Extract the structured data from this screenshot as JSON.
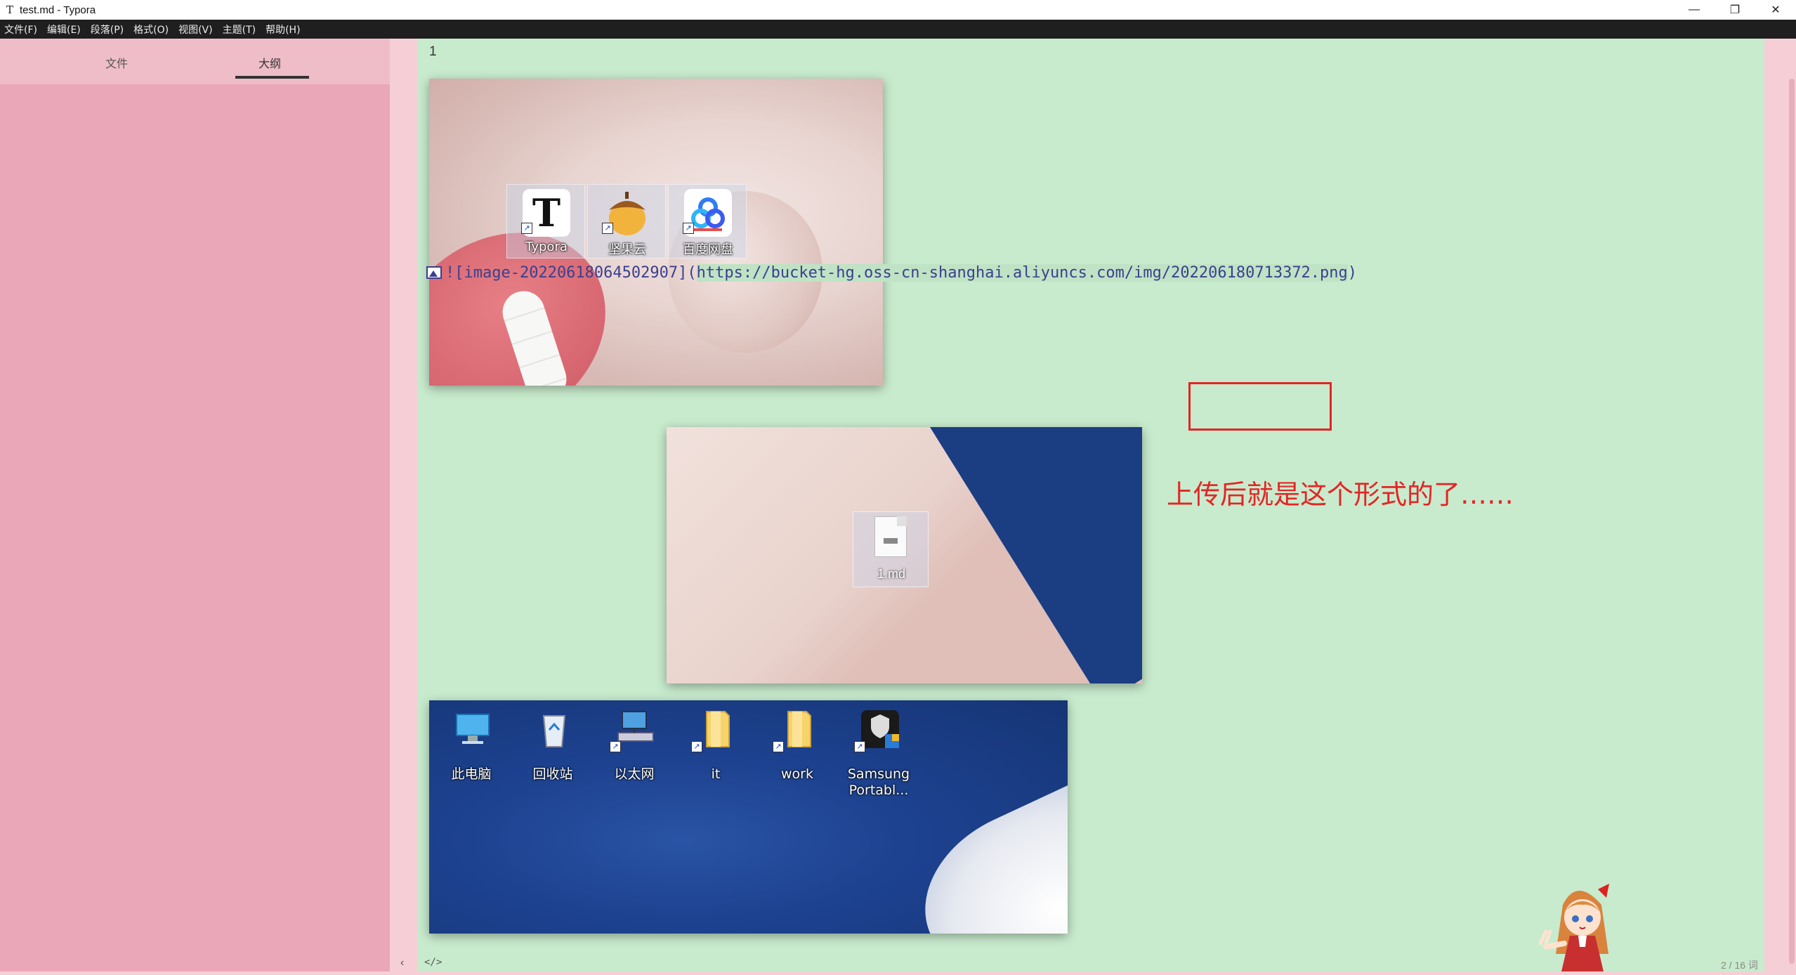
{
  "window": {
    "title": "test.md - Typora",
    "app_icon": "T",
    "controls": {
      "minimize": "—",
      "restore": "❐",
      "close": "✕"
    }
  },
  "menu": [
    "文件(F)",
    "编辑(E)",
    "段落(P)",
    "格式(O)",
    "视图(V)",
    "主题(T)",
    "帮助(H)"
  ],
  "sidebar": {
    "tabs": [
      {
        "label": "文件",
        "active": false
      },
      {
        "label": "大纲",
        "active": true
      }
    ]
  },
  "editor": {
    "line_number": "1",
    "image1_icons": [
      {
        "label": "Typora",
        "icon": "typora-icon"
      },
      {
        "label": "坚果云",
        "icon": "nutstore-icon"
      },
      {
        "label": "百度网盘",
        "icon": "baidu-netdisk-icon"
      }
    ],
    "markdown": {
      "prefix": "![image-20220618064502907](",
      "url": "https://bucket-hg.oss-cn-shanghai.aliyuncs.com/img/202206180713372.png",
      "suffix": ")"
    },
    "annotation": "上传后就是这个形式的了……",
    "image2_icon": {
      "label": "1.md",
      "icon": "markdown-file-icon"
    },
    "image3_icons": [
      {
        "label": "此电脑",
        "icon": "this-pc-icon"
      },
      {
        "label": "回收站",
        "icon": "recycle-bin-icon"
      },
      {
        "label": "以太网",
        "icon": "ethernet-icon"
      },
      {
        "label": "it",
        "icon": "folder-icon"
      },
      {
        "label": "work",
        "icon": "folder-icon"
      },
      {
        "label": "Samsung Portabl...",
        "icon": "samsung-portable-ssd-icon"
      }
    ]
  },
  "footer": {
    "toggle_sidebar": "‹",
    "source_mode": "</>",
    "word_count": "2 / 16 词"
  },
  "colors": {
    "sidebar": "#eaa7b7",
    "editor": "#c8ebcd",
    "annotation": "#e52424",
    "link": "#3b3f8f"
  }
}
